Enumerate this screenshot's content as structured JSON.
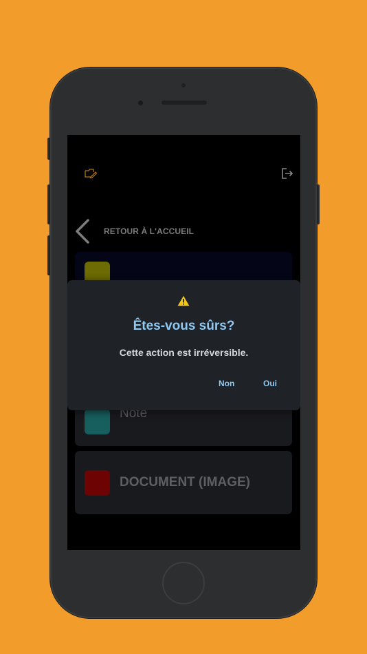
{
  "header": {
    "logo_icon": "folder-edit-icon",
    "logout_icon": "logout-icon"
  },
  "nav": {
    "back_icon": "chevron-left-icon",
    "back_label": "RETOUR À L'ACCUEIL"
  },
  "cards": [
    {
      "label": "",
      "color": "#7b7a05"
    },
    {
      "label": "Note",
      "color": "#1b6d6c"
    },
    {
      "label": "DOCUMENT (IMAGE)",
      "color": "#7d0504"
    }
  ],
  "dialog": {
    "icon": "warning-icon",
    "title": "Êtes-vous sûrs?",
    "message": "Cette action est irréversible.",
    "cancel_label": "Non",
    "confirm_label": "Oui"
  },
  "colors": {
    "background": "#f29d2b",
    "accent": "#8ecaf3",
    "warning": "#f5c518"
  }
}
